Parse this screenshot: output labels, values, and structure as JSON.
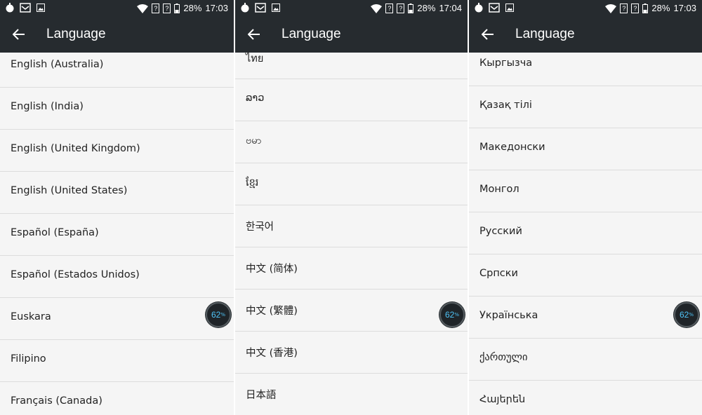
{
  "panels": [
    {
      "status": {
        "battery": "28%",
        "time": "17:03"
      },
      "title": "Language",
      "items": [
        "English (Australia)",
        "English (India)",
        "English (United Kingdom)",
        "English (United States)",
        "Español (España)",
        "Español (Estados Unidos)",
        "Euskara",
        "Filipino",
        "Français (Canada)"
      ],
      "badge": {
        "value": "62",
        "unit": "%"
      }
    },
    {
      "status": {
        "battery": "28%",
        "time": "17:04"
      },
      "title": "Language",
      "items": [
        "ไทย",
        "ລາວ",
        "ဗမာ",
        "ខ្មែរ",
        "한국어",
        "中文 (简体)",
        "中文 (繁體)",
        "中文 (香港)",
        "日本語"
      ],
      "badge": {
        "value": "62",
        "unit": "%"
      }
    },
    {
      "status": {
        "battery": "28%",
        "time": "17:03"
      },
      "title": "Language",
      "items": [
        "Кыргызча",
        "Қазақ тілі",
        "Македонски",
        "Монгол",
        "Русский",
        "Српски",
        "Українська",
        "ქართული",
        "Հայերեն"
      ],
      "badge": {
        "value": "62",
        "unit": "%"
      }
    }
  ]
}
